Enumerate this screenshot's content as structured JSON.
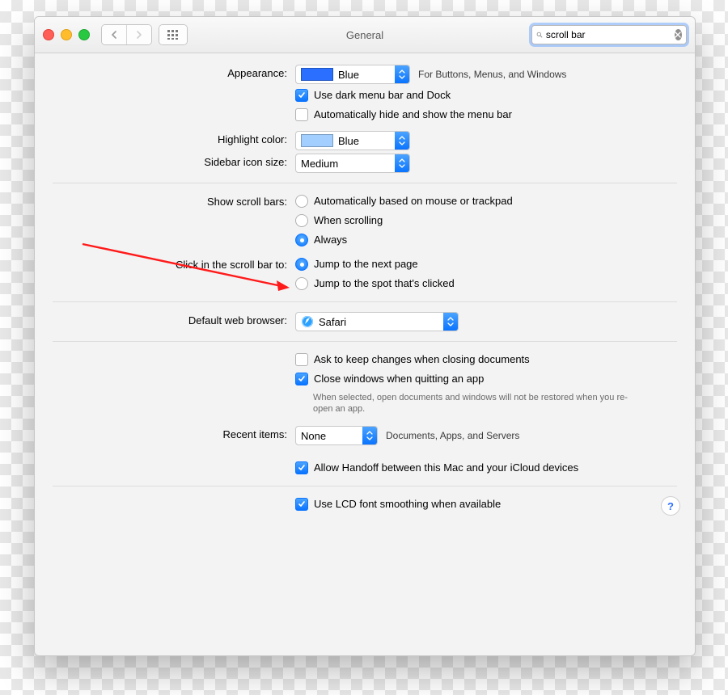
{
  "window": {
    "title": "General"
  },
  "search": {
    "value": "scroll bar"
  },
  "appearance": {
    "label": "Appearance:",
    "value": "Blue",
    "hint": "For Buttons, Menus, and Windows",
    "darkDockCheckbox": "Use dark menu bar and Dock",
    "autohideMenuBarCheckbox": "Automatically hide and show the menu bar"
  },
  "highlight": {
    "label": "Highlight color:",
    "value": "Blue"
  },
  "sidebarSize": {
    "label": "Sidebar icon size:",
    "value": "Medium"
  },
  "scrollbars": {
    "label": "Show scroll bars:",
    "opts": [
      "Automatically based on mouse or trackpad",
      "When scrolling",
      "Always"
    ],
    "selected": 2
  },
  "clickScroll": {
    "label": "Click in the scroll bar to:",
    "opts": [
      "Jump to the next page",
      "Jump to the spot that's clicked"
    ],
    "selected": 0
  },
  "browser": {
    "label": "Default web browser:",
    "value": "Safari"
  },
  "documents": {
    "askKeepChanges": "Ask to keep changes when closing documents",
    "closeOnQuit": "Close windows when quitting an app",
    "closeOnQuitHelp": "When selected, open documents and windows will not be restored when you re-open an app."
  },
  "recent": {
    "label": "Recent items:",
    "value": "None",
    "hint": "Documents, Apps, and Servers"
  },
  "handoff": "Allow Handoff between this Mac and your iCloud devices",
  "lcd": "Use LCD font smoothing when available"
}
